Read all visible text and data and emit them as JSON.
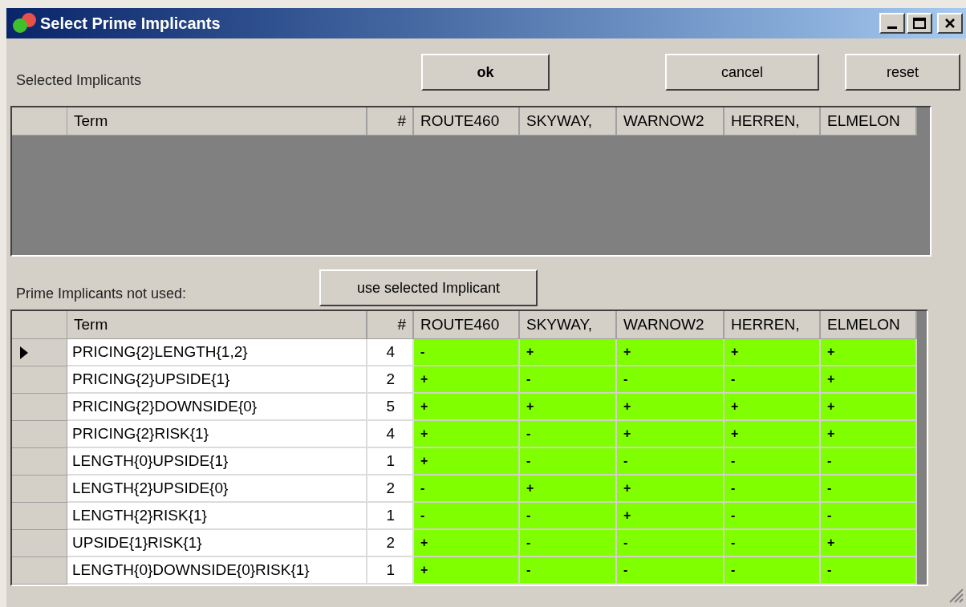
{
  "window": {
    "title": "Select Prime Implicants"
  },
  "selected_label": "Selected Implicants",
  "buttons": {
    "ok": "ok",
    "cancel": "cancel",
    "reset": "reset",
    "use": "use selected Implicant"
  },
  "selected_table": {
    "columns": [
      "Term",
      "#",
      "ROUTE460",
      "SKYWAY,",
      "WARNOW2",
      "HERREN,",
      "ELMELON"
    ]
  },
  "unused_label": "Prime Implicants not used:",
  "unused_table": {
    "columns": [
      "Term",
      "#",
      "ROUTE460",
      "SKYWAY,",
      "WARNOW2",
      "HERREN,",
      "ELMELON"
    ],
    "rows": [
      {
        "selected": true,
        "term": "PRICING{2}LENGTH{1,2}",
        "count": "4",
        "marks": [
          "-",
          "+",
          "+",
          "+",
          "+"
        ]
      },
      {
        "selected": false,
        "term": "PRICING{2}UPSIDE{1}",
        "count": "2",
        "marks": [
          "+",
          "-",
          "-",
          "-",
          "+"
        ]
      },
      {
        "selected": false,
        "term": "PRICING{2}DOWNSIDE{0}",
        "count": "5",
        "marks": [
          "+",
          "+",
          "+",
          "+",
          "+"
        ]
      },
      {
        "selected": false,
        "term": "PRICING{2}RISK{1}",
        "count": "4",
        "marks": [
          "+",
          "-",
          "+",
          "+",
          "+"
        ]
      },
      {
        "selected": false,
        "term": "LENGTH{0}UPSIDE{1}",
        "count": "1",
        "marks": [
          "+",
          "-",
          "-",
          "-",
          "-"
        ]
      },
      {
        "selected": false,
        "term": "LENGTH{2}UPSIDE{0}",
        "count": "2",
        "marks": [
          "-",
          "+",
          "+",
          "-",
          "-"
        ]
      },
      {
        "selected": false,
        "term": "LENGTH{2}RISK{1}",
        "count": "1",
        "marks": [
          "-",
          "-",
          "+",
          "-",
          "-"
        ]
      },
      {
        "selected": false,
        "term": "UPSIDE{1}RISK{1}",
        "count": "2",
        "marks": [
          "+",
          "-",
          "-",
          "-",
          "+"
        ]
      },
      {
        "selected": false,
        "term": "LENGTH{0}DOWNSIDE{0}RISK{1}",
        "count": "1",
        "marks": [
          "+",
          "-",
          "-",
          "-",
          "-"
        ]
      }
    ]
  }
}
